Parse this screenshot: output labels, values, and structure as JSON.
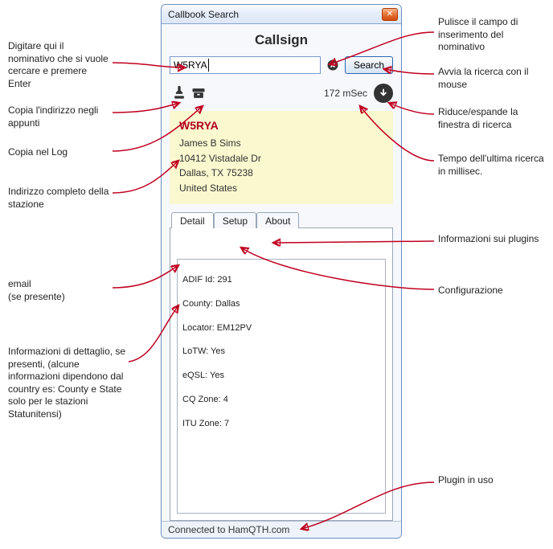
{
  "window": {
    "title": "Callbook Search"
  },
  "section_title": "Callsign",
  "search": {
    "value": "W5RYA",
    "button": "Search"
  },
  "timing": "172 mSec",
  "address": {
    "callsign": "W5RYA",
    "name": "James B Sims",
    "street": "10412 Vistadale Dr",
    "city": "Dallas, TX 75238",
    "country": "United States"
  },
  "tabs": {
    "detail": "Detail",
    "setup": "Setup",
    "about": "About"
  },
  "details": {
    "adif_id": "ADIF Id: 291",
    "county": "County: Dallas",
    "locator": "Locator: EM12PV",
    "lotw": "LoTW: Yes",
    "eqsl": "eQSL: Yes",
    "cqzone": "CQ Zone: 4",
    "ituzone": "ITU Zone: 7"
  },
  "status": "Connected to HamQTH.com",
  "annotations": {
    "input_hint": "Digitare qui il nominativo che si vuole cercare e premere Enter",
    "copy_addr": "Copia l'indirizzo negli appunti",
    "copy_log": "Copia nel Log",
    "full_addr": "Indirizzo completo della stazione",
    "email": "email\n(se presente)",
    "detail_info": "Informazioni di dettaglio, se presenti, (alcune informazioni dipendono dal country es: County e State solo per le stazioni Statunitensi)",
    "clear_field": "Pulisce il campo di inserimento del nominativo",
    "start_search": "Avvia la ricerca con il mouse",
    "collapse": "Riduce/espande la finestra di ricerca",
    "last_time": "Tempo dell'ultima ricerca in millisec.",
    "plugins_info": "Informazioni sui plugins",
    "config": "Configurazione",
    "plugin_used": "Plugin in uso"
  }
}
